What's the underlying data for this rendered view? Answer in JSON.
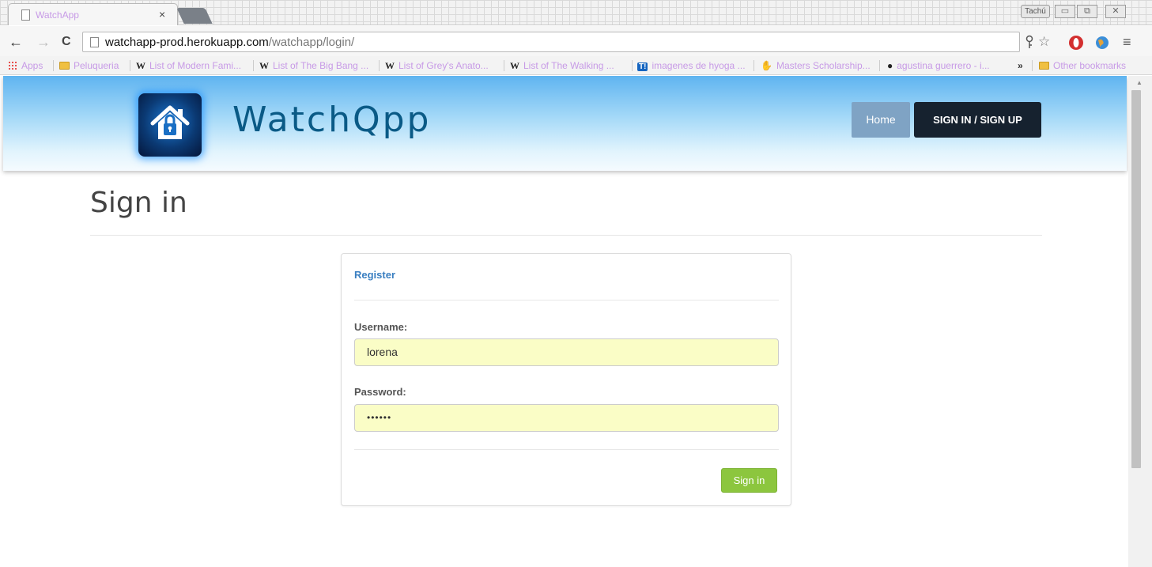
{
  "browser": {
    "tab_title": "WatchApp",
    "tab_close": "×",
    "user_button": "Tachú",
    "window_controls": {
      "minimize": "▭",
      "restore": "⧉",
      "close": "✕"
    },
    "nav_icons": {
      "back": "←",
      "forward": "→",
      "reload": "C"
    },
    "url": {
      "host": "watchapp-prod.herokuapp.com",
      "path": "/watchapp/login/"
    },
    "toolbar_icons": [
      "key-icon",
      "star-icon",
      "opera-icon",
      "globe-icon",
      "menu-icon"
    ],
    "bookmarks": [
      {
        "label": "Apps",
        "icon": "apps-grid-icon"
      },
      {
        "label": "Peluqueria",
        "icon": "folder-icon"
      },
      {
        "label": "List of Modern Fami...",
        "icon": "W"
      },
      {
        "label": "List of The Big Bang ...",
        "icon": "W"
      },
      {
        "label": "List of Grey's Anato...",
        "icon": "W"
      },
      {
        "label": "List of The Walking ...",
        "icon": "W"
      },
      {
        "label": "imagenes de hyoga ...",
        "icon": "T!"
      },
      {
        "label": "Masters Scholarship...",
        "icon": "hand-icon"
      },
      {
        "label": "agustina guerrero - i...",
        "icon": "dot-icon"
      }
    ],
    "overflow_chevron": "»",
    "other_bookmarks": "Other bookmarks"
  },
  "header": {
    "brand": "WatchQpp",
    "nav": {
      "home": "Home",
      "sign_in_up": "SIGN IN / SIGN UP"
    }
  },
  "page": {
    "title": "Sign in",
    "register_link": "Register",
    "username_label": "Username:",
    "username_value": "lorena",
    "password_label": "Password:",
    "password_value": "••••••",
    "submit": "Sign in"
  },
  "colors": {
    "header_top": "#5fb4f0",
    "header_bottom": "#f5fbff",
    "brand_text": "#0a5a86",
    "nav_home_bg": "#7fa3c4",
    "nav_sign_bg": "#16222f",
    "register_link": "#3a7fc1",
    "autofill_bg": "#fafdc6",
    "submit_bg": "#8cc63e"
  }
}
